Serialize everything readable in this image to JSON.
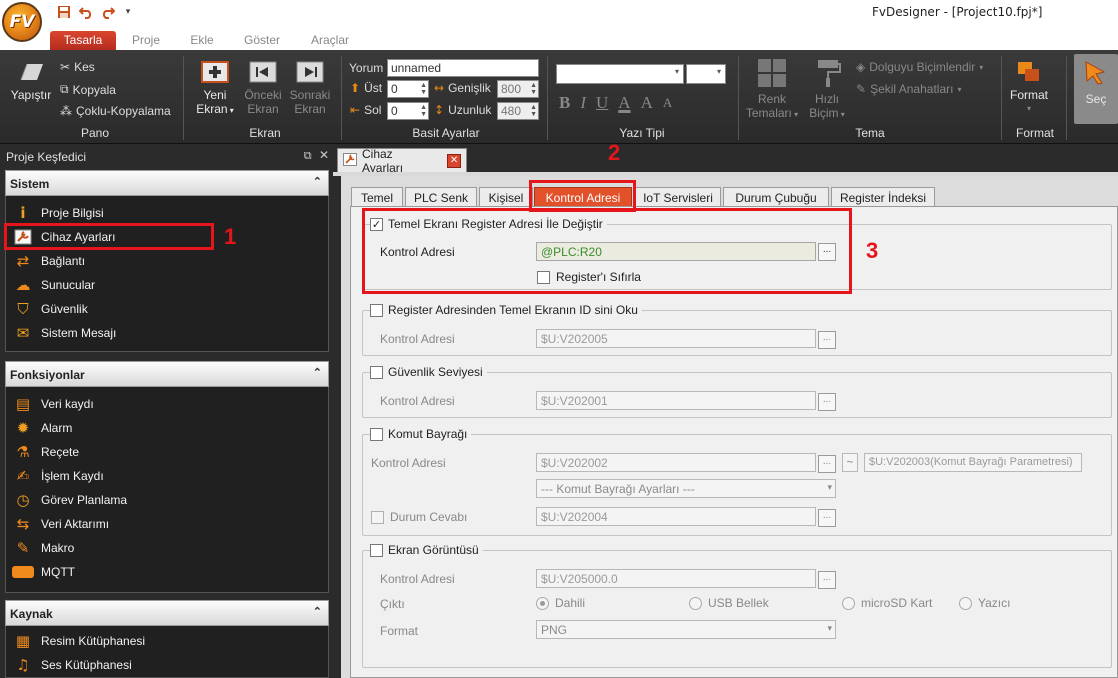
{
  "window": {
    "title": "FvDesigner - [Project10.fpj*]",
    "logo": "FV"
  },
  "quick_access": [
    "save-icon",
    "undo-icon",
    "redo-icon",
    "customize-icon"
  ],
  "ribbon_tabs": [
    "Tasarla",
    "Proje",
    "Ekle",
    "Göster",
    "Araçlar"
  ],
  "ribbon": {
    "pano": {
      "label": "Pano",
      "paste": "Yapıştır",
      "cut": "Kes",
      "copy": "Kopyala",
      "multi_copy": "Çoklu-Kopyalama"
    },
    "ekran": {
      "label": "Ekran",
      "new_line1": "Yeni",
      "new_line2": "Ekran",
      "prev_line1": "Önceki",
      "prev_line2": "Ekran",
      "next_line1": "Sonraki",
      "next_line2": "Ekran"
    },
    "basit": {
      "label": "Basit Ayarlar",
      "comment_label": "Yorum",
      "comment_value": "unnamed",
      "top_label": "Üst",
      "top_value": "0",
      "left_label": "Sol",
      "left_value": "0",
      "width_label": "Genişlik",
      "width_value": "800",
      "height_label": "Uzunluk",
      "height_value": "480"
    },
    "yazi": {
      "label": "Yazı Tipi",
      "bold": "B",
      "italic": "I",
      "underline": "U",
      "font_color": "A",
      "grow": "A",
      "shrink": "A"
    },
    "tema": {
      "label": "Tema",
      "color_line1": "Renk",
      "color_line2": "Temaları",
      "quick_line1": "Hızlı",
      "quick_line2": "Biçim",
      "fill": "Dolguyu Biçimlendir",
      "shape": "Şekil Anahatları"
    },
    "format": {
      "label": "Format",
      "btn": "Format"
    },
    "select_btn": "Seç"
  },
  "explorer": {
    "title": "Proje Keşfedici",
    "sections": [
      {
        "title": "Sistem",
        "items": [
          "Proje Bilgisi",
          "Cihaz Ayarları",
          "Bağlantı",
          "Sunucular",
          "Güvenlik",
          "Sistem Mesajı"
        ]
      },
      {
        "title": "Fonksiyonlar",
        "items": [
          "Veri kaydı",
          "Alarm",
          "Reçete",
          "İşlem Kaydı",
          "Görev Planlama",
          "Veri Aktarımı",
          "Makro",
          "MQTT"
        ]
      },
      {
        "title": "Kaynak",
        "items": [
          "Resim Kütüphanesi",
          "Ses Kütüphanesi"
        ]
      }
    ]
  },
  "annotations": [
    "1",
    "2",
    "3"
  ],
  "doc_tab": {
    "label": "Cihaz Ayarları"
  },
  "settings_tabs": [
    "Temel",
    "PLC Senk",
    "Kişisel",
    "Kontrol Adresi",
    "IoT Servisleri",
    "Durum Çubuğu",
    "Register İndeksi"
  ],
  "content": {
    "g1": {
      "title": "Temel Ekranı Register Adresi İle Değiştir",
      "checked": true,
      "addr_label": "Kontrol Adresi",
      "addr_value": "@PLC:R20",
      "reset_label": "Register'ı Sıfırla"
    },
    "g2": {
      "title": "Register Adresinden Temel Ekranın ID sini Oku",
      "addr_label": "Kontrol Adresi",
      "addr_value": "$U:V202005"
    },
    "g3": {
      "title": "Güvenlik Seviyesi",
      "addr_label": "Kontrol Adresi",
      "addr_value": "$U:V202001"
    },
    "g4": {
      "title": "Komut Bayrağı",
      "addr_label": "Kontrol Adresi",
      "addr_value": "$U:V202002",
      "tilde": "~",
      "param_value": "$U:V202003(Komut Bayrağı Parametresi)",
      "settings_select": "---  Komut Bayrağı Ayarları  ---",
      "response_label": "Durum Cevabı",
      "response_value": "$U:V202004"
    },
    "g5": {
      "title": "Ekran Görüntüsü",
      "addr_label": "Kontrol Adresi",
      "addr_value": "$U:V205000.0",
      "output_label": "Çıktı",
      "outputs": [
        "Dahili",
        "USB Bellek",
        "microSD Kart",
        "Yazıcı"
      ],
      "format_label": "Format",
      "format_value": "PNG"
    },
    "dots": "..."
  }
}
